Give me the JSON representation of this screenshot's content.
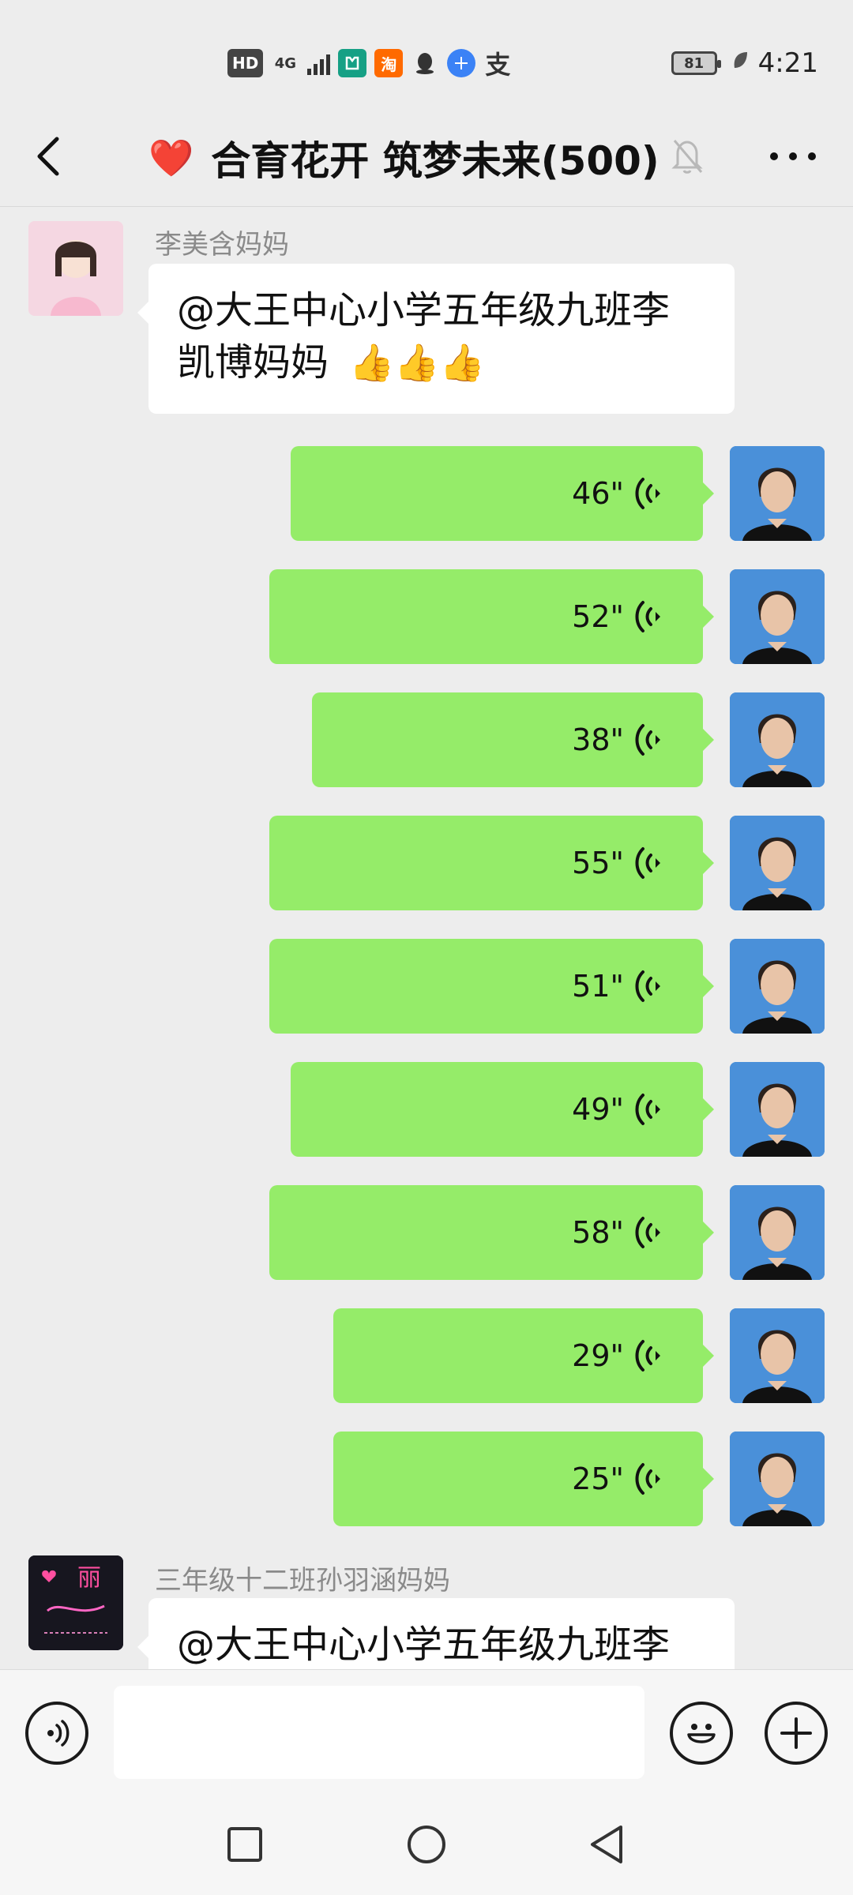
{
  "status_bar": {
    "hd": "HD",
    "network": "4G",
    "mi_icon": "mi-icon",
    "tao_label": "淘",
    "qq_icon": "qq-penguin-icon",
    "browser_icon": "browser-icon",
    "alipay_label": "支",
    "battery": "81",
    "time": "4:21"
  },
  "header": {
    "title": "合育花开 筑梦未来(500)",
    "emoji": "❤️"
  },
  "messages": {
    "msg1": {
      "sender": "李美含妈妈",
      "line1": "@大王中心小学五年级九班李",
      "line2": "凯博妈妈",
      "emoji": "👍👍👍"
    },
    "voices": [
      "46\"",
      "52\"",
      "38\"",
      "55\"",
      "51\"",
      "49\"",
      "58\"",
      "29\"",
      "25\""
    ],
    "msg2": {
      "sender": "三年级十二班孙羽涵妈妈",
      "line1": "@大王中心小学五年级九班李",
      "avatar_text": "丽"
    }
  },
  "colors": {
    "background": "#ededed",
    "voice_bubble": "#95ec69",
    "incoming_bubble": "#ffffff",
    "heart": "#e11d2e"
  }
}
